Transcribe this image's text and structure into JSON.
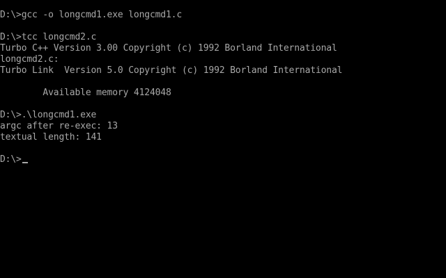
{
  "terminal": {
    "foreground_color": "#a8a8a8",
    "background_color": "#000000",
    "lines": [
      "D:\\>gcc -o longcmd1.exe longcmd1.c",
      "",
      "D:\\>tcc longcmd2.c",
      "Turbo C++ Version 3.00 Copyright (c) 1992 Borland International",
      "longcmd2.c:",
      "Turbo Link  Version 5.0 Copyright (c) 1992 Borland International",
      "",
      "        Available memory 4124048",
      "",
      "D:\\>.\\longcmd1.exe",
      "argc after re-exec: 13",
      "textual length: 141",
      "",
      "D:\\>"
    ]
  }
}
